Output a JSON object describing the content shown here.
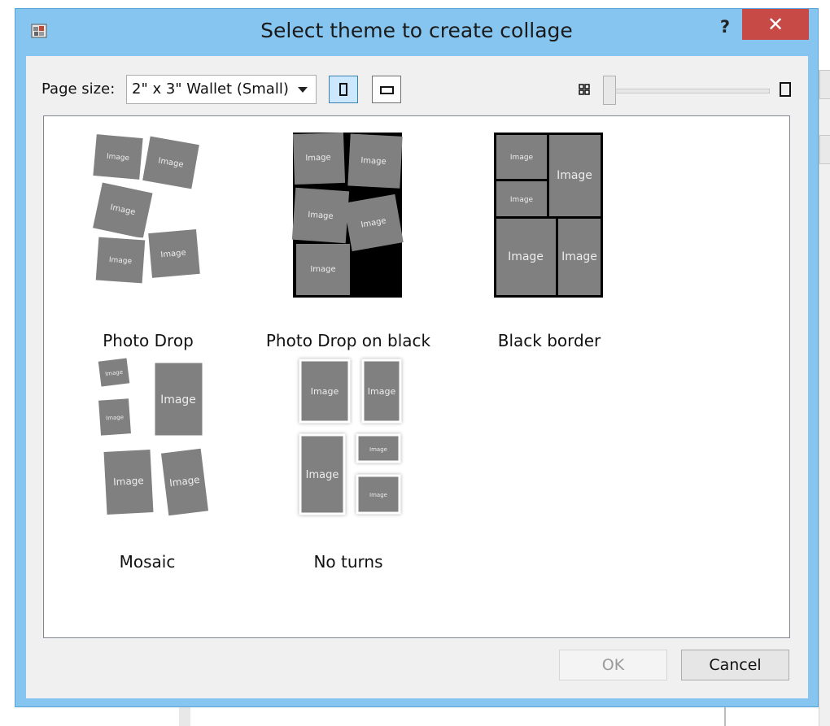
{
  "window": {
    "title": "Select theme to create collage",
    "help_label": "?",
    "close_label": "✕"
  },
  "toolbar": {
    "page_size_label": "Page size:",
    "page_size_value": "2\" x 3\" Wallet (Small)"
  },
  "placeholder_text": "Image",
  "themes": [
    {
      "label": "Photo Drop"
    },
    {
      "label": "Photo Drop on black"
    },
    {
      "label": "Black border"
    },
    {
      "label": "Mosaic"
    },
    {
      "label": "No turns"
    }
  ],
  "buttons": {
    "ok": "OK",
    "cancel": "Cancel"
  },
  "colors": {
    "title_bar": "#87c5f1",
    "close_button": "#c74a47",
    "tile_gray": "#808080",
    "selected_toggle": "#cce8ff"
  }
}
